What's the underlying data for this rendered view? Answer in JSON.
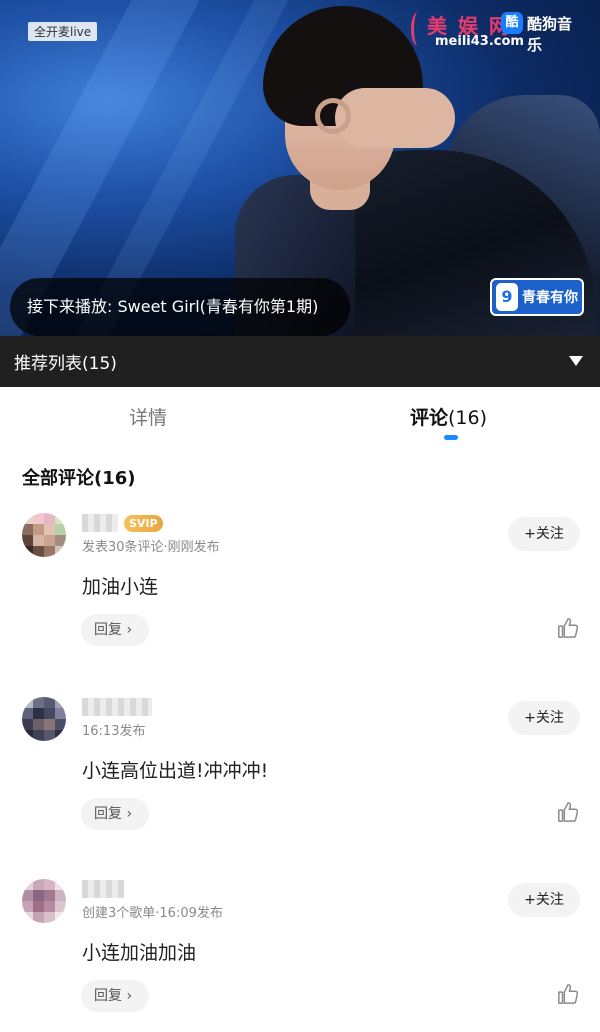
{
  "video": {
    "live_badge": "全开麦live",
    "watermark_site_cn": "美 娱 网",
    "watermark_site_url": "meili43.com",
    "watermark_app_icon": "酷",
    "watermark_app_name": "酷狗音乐",
    "show_logo_mark": "9",
    "show_logo_text": "青春有你",
    "next_up_label": "接下来播放:",
    "next_up_title": "Sweet Girl(青春有你第1期)"
  },
  "playlist": {
    "label": "推荐列表(15)",
    "icon": "chevron-down-icon"
  },
  "tabs": {
    "details": "详情",
    "comments_label": "评论",
    "comments_count": "(16)",
    "accent_color": "#1a8cff"
  },
  "comments_section": {
    "title": "全部评论(16)",
    "follow_label": "+关注",
    "reply_label": "回复",
    "comments": [
      {
        "badge": "SVIP",
        "meta": "发表30条评论·刚刚发布",
        "text": "加油小连"
      },
      {
        "badge": "",
        "meta": "16:13发布",
        "text": "小连高位出道!冲冲冲!"
      },
      {
        "badge": "",
        "meta": "创建3个歌单·16:09发布",
        "text": "小连加油加油"
      }
    ]
  }
}
